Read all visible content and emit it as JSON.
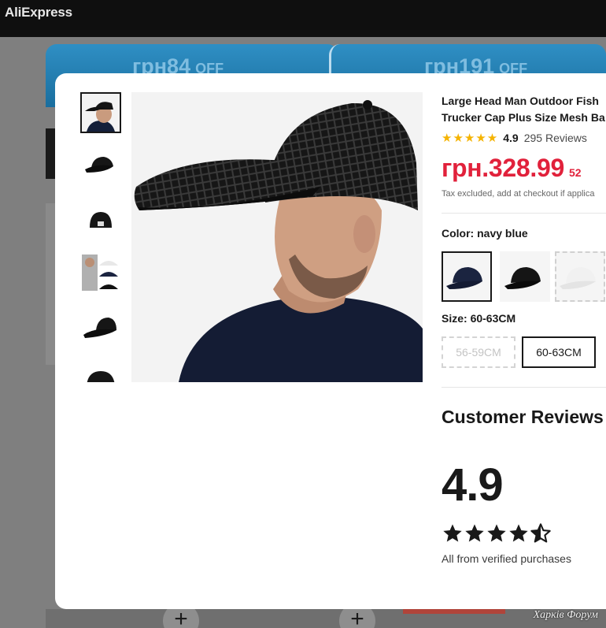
{
  "header": {
    "logo": "AliExpress"
  },
  "coupons": [
    {
      "amount": "грн84",
      "suffix": "OFF"
    },
    {
      "amount": "грн191",
      "suffix": "OFF"
    }
  ],
  "background": {
    "plus_label": "+"
  },
  "watermark": "Харків Форум",
  "product": {
    "title_line1": "Large Head Man Outdoor Fish",
    "title_line2": "Trucker Cap Plus Size Mesh Ba",
    "rating": "4.9",
    "review_count": "295 Reviews",
    "price": "грн.328.99",
    "original_price": "52",
    "tax_note": "Tax excluded, add at checkout if applica",
    "color_label": "Color: navy blue",
    "size_label": "Size: 60-63CM",
    "sizes": [
      "56-59CM",
      "60-63CM"
    ],
    "selected_size": "60-63CM",
    "colors": {
      "navy": "#1b2440",
      "black": "#111111",
      "white": "#f1f1f1"
    },
    "accent_color": "#e1213b"
  },
  "reviews": {
    "heading": "Customer Reviews",
    "average": "4.9",
    "stars_filled": 4.5,
    "verified_text": "All from verified purchases"
  }
}
